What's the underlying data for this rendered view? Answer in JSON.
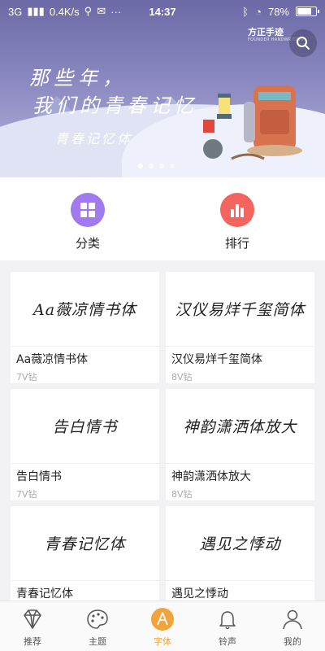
{
  "status_bar": {
    "network": "3G",
    "speed": "0.4K/s",
    "time": "14:37",
    "battery_text": "78%",
    "battery_level": 0.78
  },
  "banner": {
    "brand": "方正手迹",
    "brand_sub": "FOUNDER HANDWRITING",
    "line1": "那些年，",
    "line2": "我们的青春记忆",
    "subtitle": "青春记忆体",
    "dots": 4,
    "active_dot": 0
  },
  "quick": {
    "category": {
      "label": "分类",
      "icon": "grid-icon",
      "color": "#a17af0"
    },
    "ranking": {
      "label": "排行",
      "icon": "bar-chart-icon",
      "color": "#f4655f"
    }
  },
  "fonts": [
    {
      "preview": "Aa薇凉情书体",
      "name": "Aa薇凉情书体",
      "price": "7V钻"
    },
    {
      "preview": "汉仪易烊千玺简体",
      "name": "汉仪易烊千玺简体",
      "price": "8V钻"
    },
    {
      "preview": "告白情书",
      "name": "告白情书",
      "price": "7V钻"
    },
    {
      "preview": "神韵潇洒体放大",
      "name": "神韵潇洒体放大",
      "price": "8V钻"
    },
    {
      "preview": "青春记忆体",
      "name": "青春记忆体",
      "price": ""
    },
    {
      "preview": "遇见之悸动",
      "name": "遇见之悸动",
      "price": ""
    }
  ],
  "nav": [
    {
      "label": "推荐",
      "icon": "diamond-icon",
      "active": false
    },
    {
      "label": "主题",
      "icon": "palette-icon",
      "active": false
    },
    {
      "label": "字体",
      "icon": "font-a-icon",
      "active": true
    },
    {
      "label": "铃声",
      "icon": "bell-icon",
      "active": false
    },
    {
      "label": "我的",
      "icon": "person-icon",
      "active": false
    }
  ],
  "colors": {
    "accent": "#f2a33a",
    "banner_top": "#6c6aa6"
  }
}
